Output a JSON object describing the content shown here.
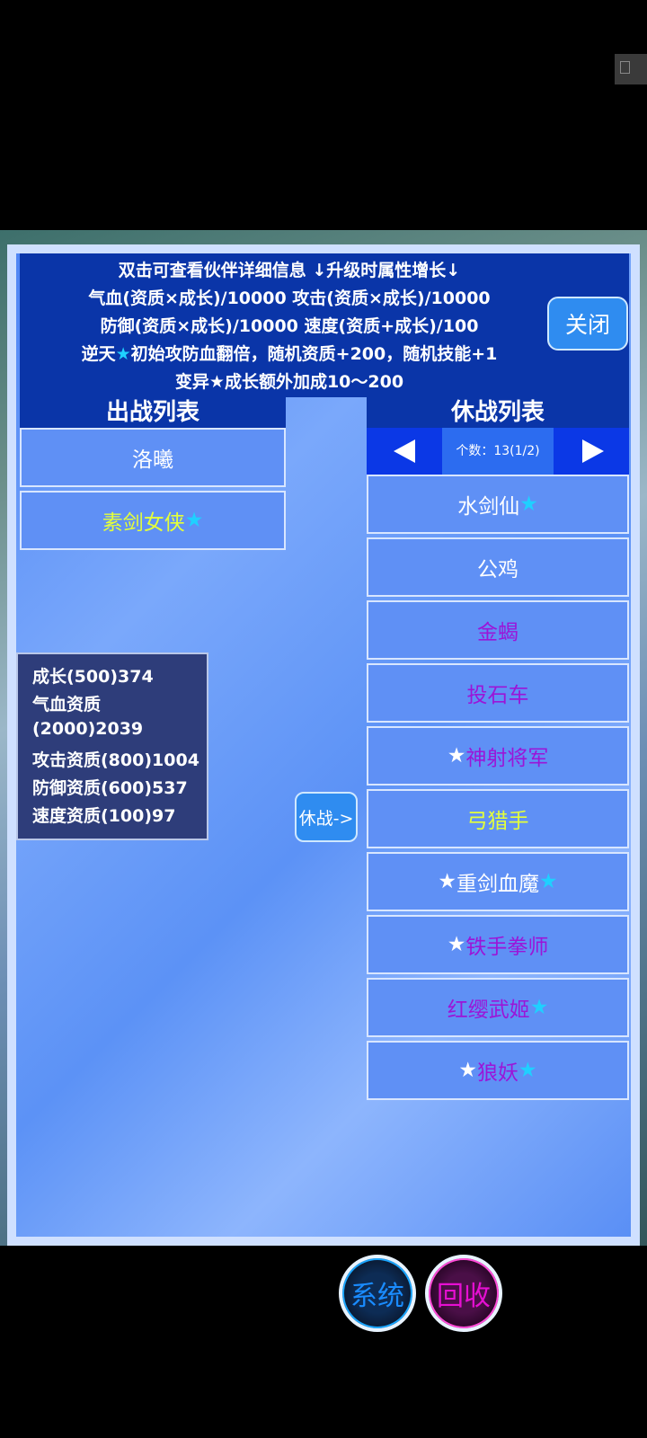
{
  "info": {
    "line1": "双击可查看伙伴详细信息 ↓升级时属性增长↓",
    "line2": "气血(资质×成长)/10000 攻击(资质×成长)/10000",
    "line3": "防御(资质×成长)/10000 速度(资质+成长)/100",
    "line4_pre": "逆天",
    "line4_star": "★",
    "line4_post": "初始攻防血翻倍，随机资质+200，随机技能+1",
    "line5": "变异★成长额外加成10～200"
  },
  "close_label": "关闭",
  "battle_list": {
    "title": "出战列表",
    "items": [
      {
        "pre": "",
        "name": "洛曦",
        "post": "",
        "color": "#ffffff"
      },
      {
        "pre": "",
        "name": "素剑女侠",
        "post": "★",
        "color": "#e4ff3a"
      }
    ]
  },
  "rest_list": {
    "title": "休战列表",
    "count_label": "个数：13(1/2)",
    "items": [
      {
        "pre": "",
        "name": "水剑仙",
        "post": "★",
        "color": "#ffffff"
      },
      {
        "pre": "",
        "name": "公鸡",
        "post": "",
        "color": "#ffffff"
      },
      {
        "pre": "",
        "name": "金蝎",
        "post": "",
        "color": "#9b15d8"
      },
      {
        "pre": "",
        "name": "投石车",
        "post": "",
        "color": "#9b15d8"
      },
      {
        "pre": "★",
        "name": "神射将军",
        "post": "",
        "color": "#9b15d8"
      },
      {
        "pre": "",
        "name": "弓猎手",
        "post": "",
        "color": "#e4ff3a"
      },
      {
        "pre": "★",
        "name": "重剑血魔",
        "post": "★",
        "color": "#ffffff"
      },
      {
        "pre": "★",
        "name": "铁手拳师",
        "post": "",
        "color": "#9b15d8"
      },
      {
        "pre": "",
        "name": "红缨武姬",
        "post": "★",
        "color": "#9b15d8"
      },
      {
        "pre": "★",
        "name": "狼妖",
        "post": "★",
        "color": "#9b15d8"
      }
    ]
  },
  "stats": {
    "line1": "成长(500)374",
    "line2": "气血资质",
    "line3": "(2000)2039",
    "line4": "攻击资质(800)1004",
    "line5": "防御资质(600)537",
    "line6": "速度资质(100)97"
  },
  "rest_button_label": "休战->",
  "system_button_label": "系统",
  "recycle_button_label": "回收",
  "icons": {
    "prev": "arrow-left-icon",
    "next": "arrow-right-icon"
  },
  "colors": {
    "panel_bg": "#5c92f6",
    "header_bg": "#0a35a8",
    "star": "#1fd0ff"
  }
}
